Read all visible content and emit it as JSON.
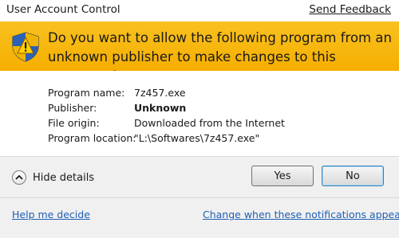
{
  "window": {
    "title": "User Account Control",
    "send_feedback": "Send Feedback"
  },
  "banner": {
    "icon": "uac-shield-icon",
    "message": "Do you want to allow the following program from an unknown publisher to make changes to this computer?"
  },
  "details": {
    "rows": [
      {
        "label": "Program name:",
        "value": "7z457.exe"
      },
      {
        "label": "Publisher:",
        "value": "Unknown"
      },
      {
        "label": "File origin:",
        "value": "Downloaded from the Internet"
      },
      {
        "label": "Program location:",
        "value": "\"L:\\Softwares\\7z457.exe\""
      }
    ]
  },
  "footer": {
    "hide_details": "Hide details",
    "yes": "Yes",
    "no": "No",
    "help_link": "Help me decide",
    "change_link": "Change when these notifications appear"
  },
  "colors": {
    "banner": "#f5ae00",
    "link": "#1f5fb5"
  }
}
